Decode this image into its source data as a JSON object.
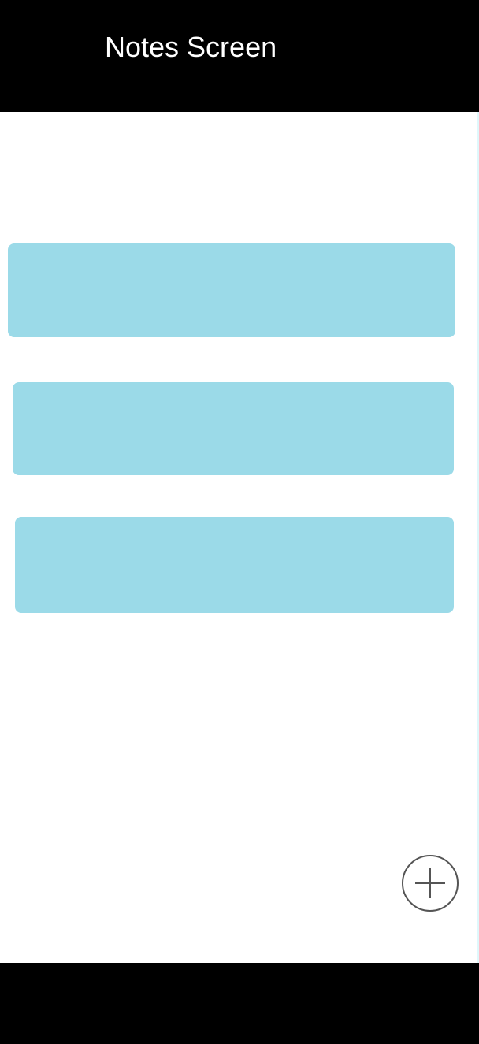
{
  "header": {
    "title": "Notes Screen"
  },
  "notes": [
    {
      "title": "",
      "preview": ""
    },
    {
      "title": "",
      "preview": ""
    },
    {
      "title": "",
      "preview": ""
    }
  ],
  "actions": {
    "add_icon": "plus-icon"
  },
  "colors": {
    "header_background": "#000000",
    "header_text": "#ffffff",
    "note_card": "#9bdae8",
    "add_button_outline": "#555555",
    "footer_background": "#000000"
  }
}
